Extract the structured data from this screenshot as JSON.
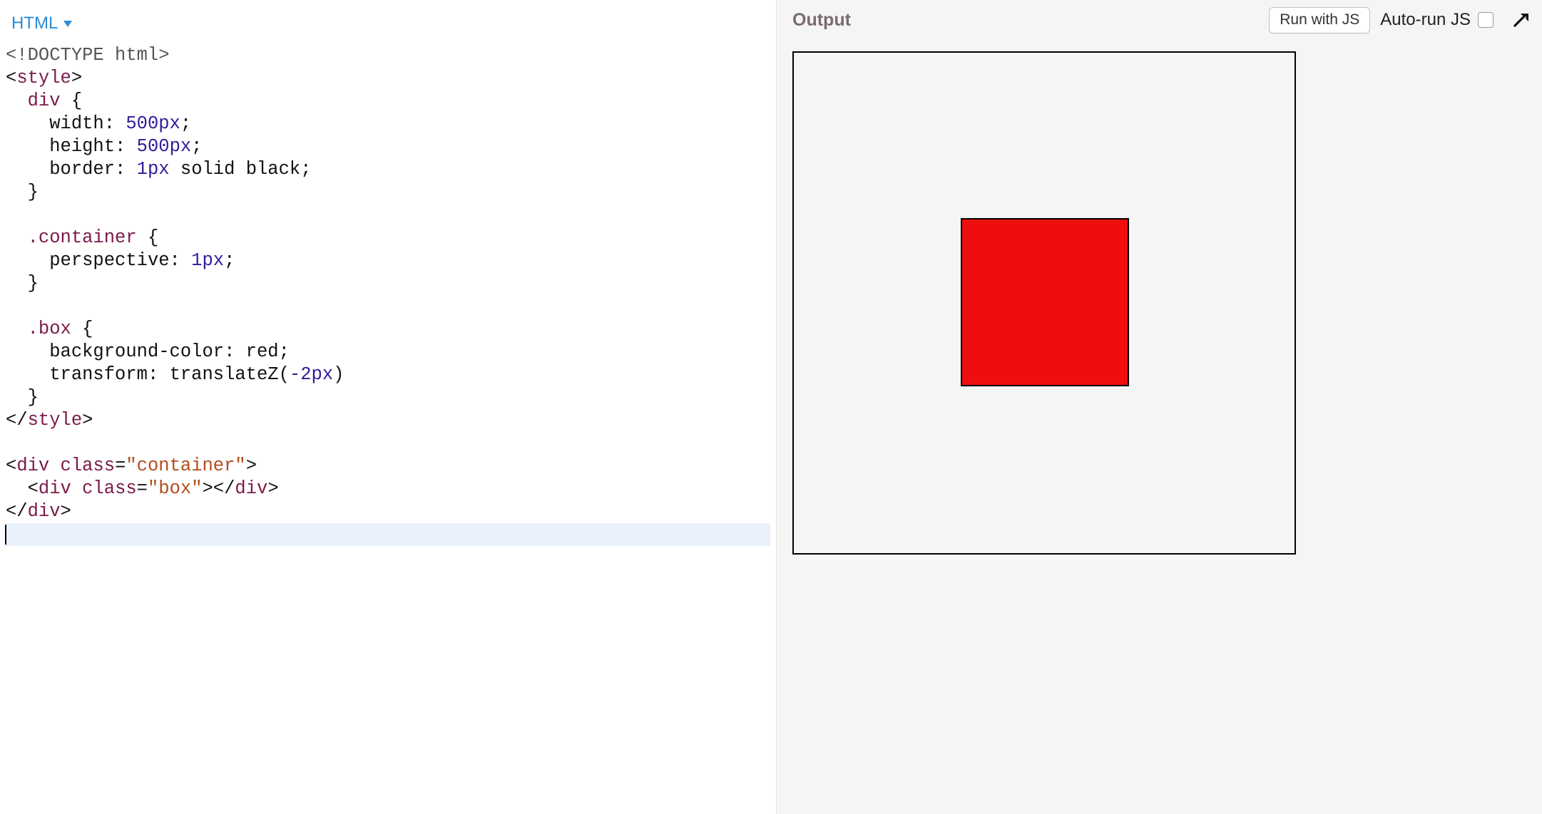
{
  "left": {
    "lang_label": "HTML"
  },
  "right": {
    "title": "Output",
    "run_label": "Run with JS",
    "autorun_label": "Auto-run JS",
    "autorun_checked": false
  },
  "icons": {
    "lang_chevron": "chevron-down-icon",
    "expand": "expand-icon"
  },
  "code": {
    "lines": [
      [
        {
          "cls": "t-doctype",
          "text": "<!DOCTYPE html>"
        }
      ],
      [
        {
          "cls": "t-punct",
          "text": "<"
        },
        {
          "cls": "t-tag",
          "text": "style"
        },
        {
          "cls": "t-punct",
          "text": ">"
        }
      ],
      [
        {
          "cls": "t-punct",
          "text": "  "
        },
        {
          "cls": "t-sel",
          "text": "div"
        },
        {
          "cls": "t-punct",
          "text": " {"
        }
      ],
      [
        {
          "cls": "t-punct",
          "text": "    "
        },
        {
          "cls": "t-prop",
          "text": "width"
        },
        {
          "cls": "t-punct",
          "text": ": "
        },
        {
          "cls": "t-num",
          "text": "500px"
        },
        {
          "cls": "t-punct",
          "text": ";"
        }
      ],
      [
        {
          "cls": "t-punct",
          "text": "    "
        },
        {
          "cls": "t-prop",
          "text": "height"
        },
        {
          "cls": "t-punct",
          "text": ": "
        },
        {
          "cls": "t-num",
          "text": "500px"
        },
        {
          "cls": "t-punct",
          "text": ";"
        }
      ],
      [
        {
          "cls": "t-punct",
          "text": "    "
        },
        {
          "cls": "t-prop",
          "text": "border"
        },
        {
          "cls": "t-punct",
          "text": ": "
        },
        {
          "cls": "t-num",
          "text": "1px"
        },
        {
          "cls": "t-punct",
          "text": " "
        },
        {
          "cls": "t-val",
          "text": "solid black"
        },
        {
          "cls": "t-punct",
          "text": ";"
        }
      ],
      [
        {
          "cls": "t-punct",
          "text": "  }"
        }
      ],
      [
        {
          "cls": "t-punct",
          "text": ""
        }
      ],
      [
        {
          "cls": "t-punct",
          "text": "  "
        },
        {
          "cls": "t-sel",
          "text": ".container"
        },
        {
          "cls": "t-punct",
          "text": " {"
        }
      ],
      [
        {
          "cls": "t-punct",
          "text": "    "
        },
        {
          "cls": "t-prop",
          "text": "perspective"
        },
        {
          "cls": "t-punct",
          "text": ": "
        },
        {
          "cls": "t-num",
          "text": "1px"
        },
        {
          "cls": "t-punct",
          "text": ";"
        }
      ],
      [
        {
          "cls": "t-punct",
          "text": "  }"
        }
      ],
      [
        {
          "cls": "t-punct",
          "text": ""
        }
      ],
      [
        {
          "cls": "t-punct",
          "text": "  "
        },
        {
          "cls": "t-sel",
          "text": ".box"
        },
        {
          "cls": "t-punct",
          "text": " {"
        }
      ],
      [
        {
          "cls": "t-punct",
          "text": "    "
        },
        {
          "cls": "t-prop",
          "text": "background-color"
        },
        {
          "cls": "t-punct",
          "text": ": "
        },
        {
          "cls": "t-val",
          "text": "red"
        },
        {
          "cls": "t-punct",
          "text": ";"
        }
      ],
      [
        {
          "cls": "t-punct",
          "text": "    "
        },
        {
          "cls": "t-prop",
          "text": "transform"
        },
        {
          "cls": "t-punct",
          "text": ": "
        },
        {
          "cls": "t-func",
          "text": "translateZ"
        },
        {
          "cls": "t-punct",
          "text": "("
        },
        {
          "cls": "t-num",
          "text": "-2px"
        },
        {
          "cls": "t-punct",
          "text": ")"
        }
      ],
      [
        {
          "cls": "t-punct",
          "text": "  }"
        }
      ],
      [
        {
          "cls": "t-punct",
          "text": "<"
        },
        {
          "cls": "t-punct",
          "text": "/"
        },
        {
          "cls": "t-tag",
          "text": "style"
        },
        {
          "cls": "t-punct",
          "text": ">"
        }
      ],
      [
        {
          "cls": "t-punct",
          "text": ""
        }
      ],
      [
        {
          "cls": "t-punct",
          "text": "<"
        },
        {
          "cls": "t-tag",
          "text": "div"
        },
        {
          "cls": "t-punct",
          "text": " "
        },
        {
          "cls": "t-attr",
          "text": "class"
        },
        {
          "cls": "t-punct",
          "text": "="
        },
        {
          "cls": "t-str",
          "text": "\"container\""
        },
        {
          "cls": "t-punct",
          "text": ">"
        }
      ],
      [
        {
          "cls": "t-punct",
          "text": "  <"
        },
        {
          "cls": "t-tag",
          "text": "div"
        },
        {
          "cls": "t-punct",
          "text": " "
        },
        {
          "cls": "t-attr",
          "text": "class"
        },
        {
          "cls": "t-punct",
          "text": "="
        },
        {
          "cls": "t-str",
          "text": "\"box\""
        },
        {
          "cls": "t-punct",
          "text": "></"
        },
        {
          "cls": "t-tag",
          "text": "div"
        },
        {
          "cls": "t-punct",
          "text": ">"
        }
      ],
      [
        {
          "cls": "t-punct",
          "text": "</"
        },
        {
          "cls": "t-tag",
          "text": "div"
        },
        {
          "cls": "t-punct",
          "text": ">"
        }
      ],
      [
        {
          "cls": "t-punct",
          "text": ""
        }
      ]
    ],
    "current_line_index": 21
  },
  "preview": {
    "container_border_color": "#000000",
    "box_color": "#ee0e0e"
  }
}
